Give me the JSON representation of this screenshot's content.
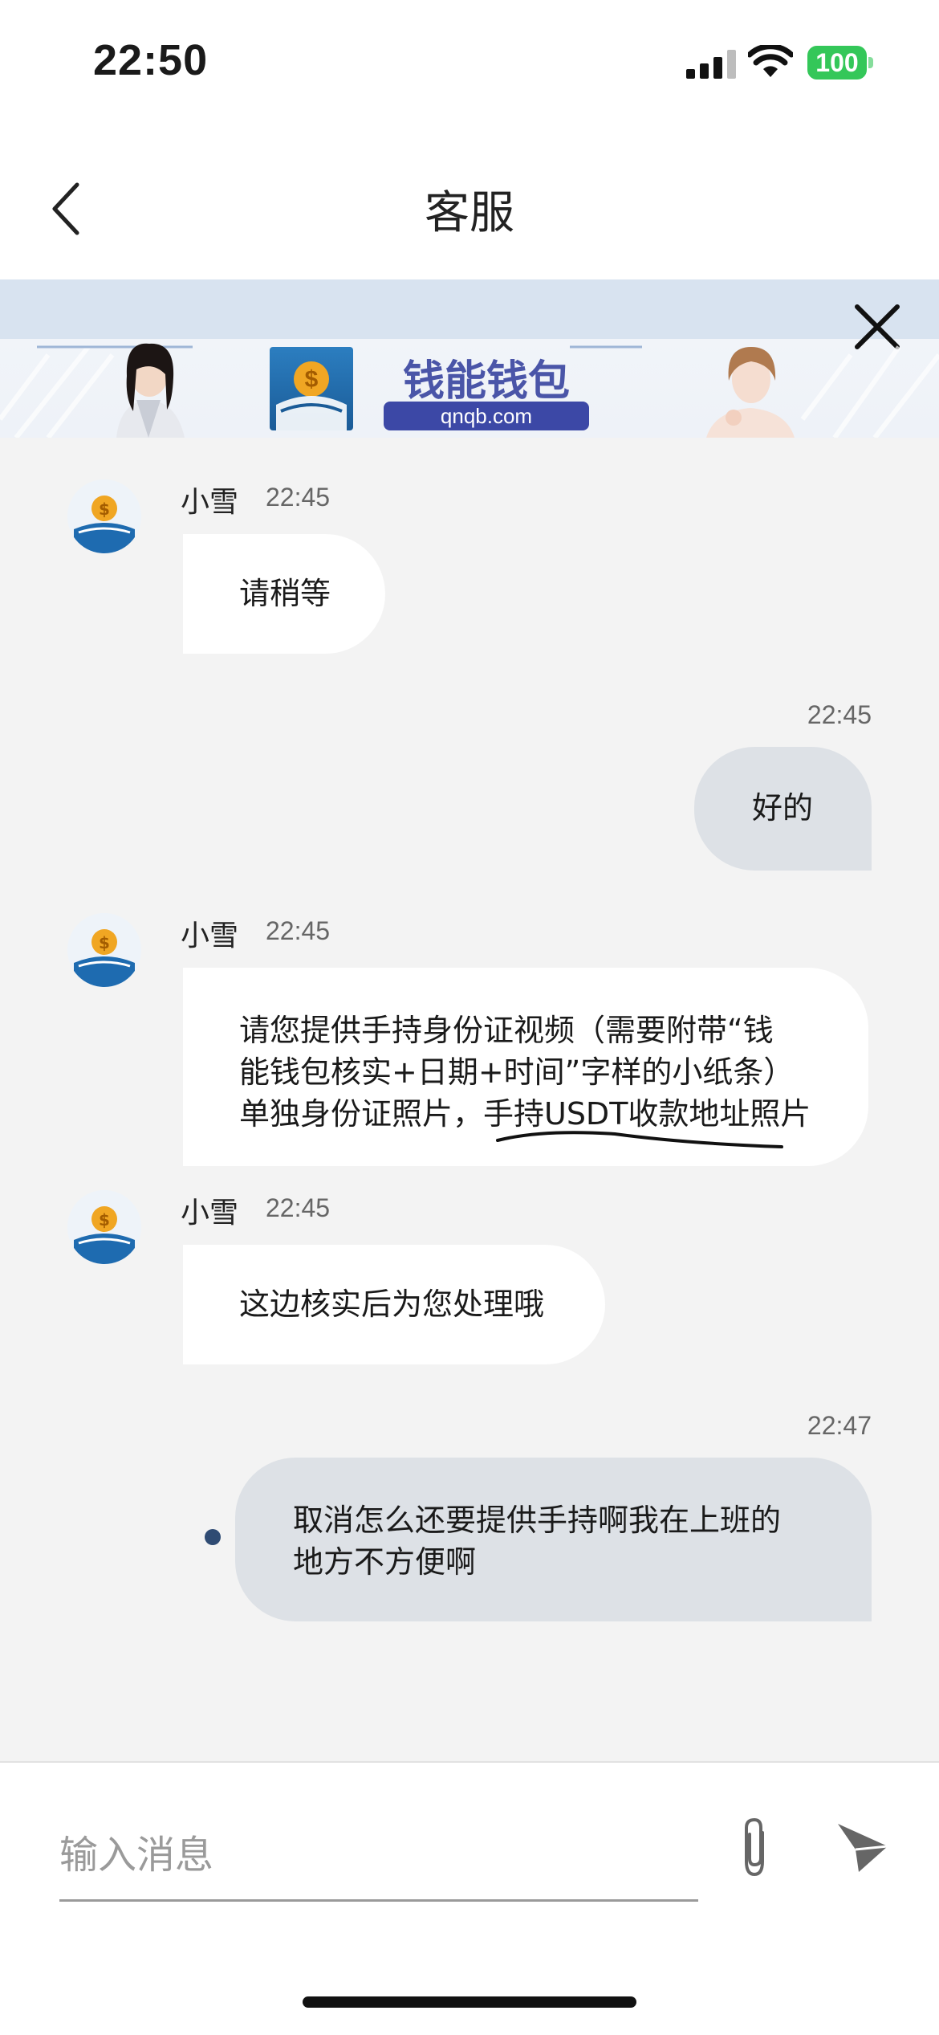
{
  "status_bar": {
    "time": "22:50",
    "battery": "100"
  },
  "header": {
    "title": "客服"
  },
  "banner": {
    "brand": "钱能钱包",
    "url": "qnqb.com"
  },
  "messages": [
    {
      "direction": "in",
      "sender": "小雪",
      "time": "22:45",
      "text": "请稍等"
    },
    {
      "direction": "out",
      "time": "22:45",
      "text": "好的"
    },
    {
      "direction": "in",
      "sender": "小雪",
      "time": "22:45",
      "lines": [
        "请您提供手持身份证视频（需要附带“钱",
        "能钱包核实+日期+时间”字样的小纸条）",
        "单独身份证照片，手持USDT收款地址照片"
      ]
    },
    {
      "direction": "in",
      "sender": "小雪",
      "time": "22:45",
      "text": "这边核实后为您处理哦"
    },
    {
      "direction": "out",
      "time": "22:47",
      "lines": [
        "取消怎么还要提供手持啊我在上班的",
        "地方不方便啊"
      ]
    }
  ],
  "composer": {
    "placeholder": "输入消息"
  },
  "colors": {
    "incoming_bubble": "#ffffff",
    "outgoing_bubble": "#dde1e6",
    "chat_bg": "#f3f3f3",
    "battery": "#34c759"
  }
}
